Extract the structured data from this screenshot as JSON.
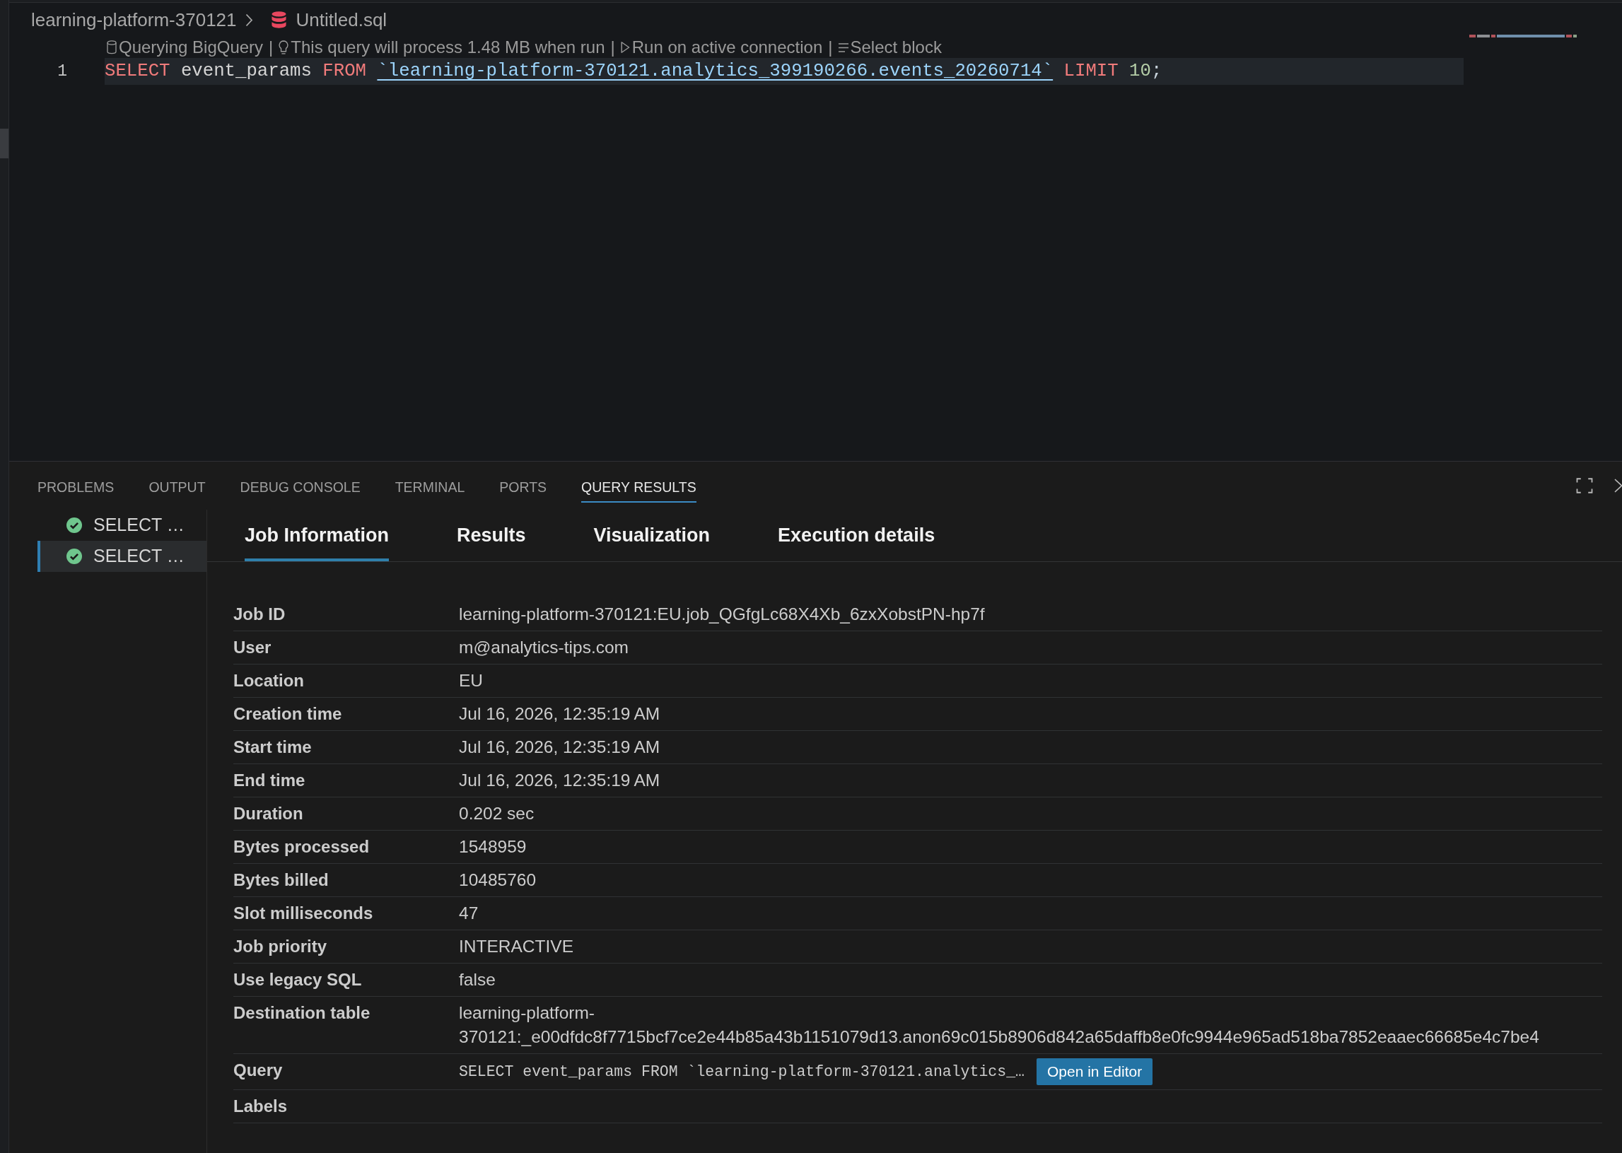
{
  "breadcrumb": [
    {
      "kind": "folder",
      "label": "learning-platform-370121"
    },
    {
      "kind": "sql_file",
      "label": "Untitled.sql"
    }
  ],
  "code_lens": [
    {
      "kind": "database",
      "label": "Querying BigQuery",
      "separator": "|"
    },
    {
      "kind": "lightbulb",
      "label": "This query will process 1.48 MB when run",
      "separator": "|"
    },
    {
      "kind": "run",
      "label": "Run on active connection",
      "separator": "|"
    },
    {
      "kind": "select",
      "label": "Select block"
    }
  ],
  "editor": {
    "lines": [
      {
        "number": "1",
        "current": true,
        "tokens": [
          {
            "kind": "keyword",
            "text": "SELECT"
          },
          {
            "kind": "plain",
            "text": "event_params"
          },
          {
            "kind": "keyword",
            "text": "FROM"
          },
          {
            "kind": "table_ref",
            "text": "`learning-platform-370121.analytics_399190266.events_20260714`"
          },
          {
            "kind": "keyword",
            "text": "LIMIT"
          },
          {
            "kind": "number",
            "text": "10"
          },
          {
            "kind": "punctuation",
            "text": ";"
          }
        ]
      }
    ]
  },
  "panel": {
    "tabs": [
      {
        "label": "PROBLEMS",
        "selected": false
      },
      {
        "label": "OUTPUT",
        "selected": false
      },
      {
        "label": "DEBUG CONSOLE",
        "selected": false
      },
      {
        "label": "TERMINAL",
        "selected": false
      },
      {
        "label": "PORTS",
        "selected": false
      },
      {
        "label": "QUERY RESULTS",
        "selected": true
      }
    ]
  },
  "query_history": [
    {
      "label": "SELECT …",
      "success": true,
      "selected": false
    },
    {
      "label": "SELECT …",
      "success": true,
      "selected": true
    }
  ],
  "result_tabs": [
    {
      "label": "Job Information",
      "selected": true
    },
    {
      "label": "Results",
      "selected": false
    },
    {
      "label": "Visualization",
      "selected": false
    },
    {
      "label": "Execution details",
      "selected": false
    }
  ],
  "job_information": {
    "rows": [
      {
        "kind": "text",
        "label": "Job ID",
        "value": "learning-platform-370121:EU.job_QGfgLc68X4Xb_6zxXobstPN-hp7f"
      },
      {
        "kind": "text",
        "label": "User",
        "value": "m@analytics-tips.com"
      },
      {
        "kind": "text",
        "label": "Location",
        "value": "EU"
      },
      {
        "kind": "text",
        "label": "Creation time",
        "value": "Jul 16, 2026, 12:35:19 AM"
      },
      {
        "kind": "text",
        "label": "Start time",
        "value": "Jul 16, 2026, 12:35:19 AM"
      },
      {
        "kind": "text",
        "label": "End time",
        "value": "Jul 16, 2026, 12:35:19 AM"
      },
      {
        "kind": "text",
        "label": "Duration",
        "value": "0.202 sec"
      },
      {
        "kind": "text",
        "label": "Bytes processed",
        "value": "1548959"
      },
      {
        "kind": "text",
        "label": "Bytes billed",
        "value": "10485760"
      },
      {
        "kind": "text",
        "label": "Slot milliseconds",
        "value": "47"
      },
      {
        "kind": "text",
        "label": "Job priority",
        "value": "INTERACTIVE"
      },
      {
        "kind": "text",
        "label": "Use legacy SQL",
        "value": "false"
      },
      {
        "kind": "text",
        "label": "Destination table",
        "value": "learning-platform-370121:_e00dfdc8f7715bcf7ce2e44b85a43b1151079d13.anon69c015b8906d842a65daffb8e0fc9944e965ad518ba7852eaaec66685e4c7be4"
      },
      {
        "kind": "query",
        "label": "Query",
        "value": "SELECT event_params FROM `learning-platform-370121.analytics_…",
        "button": "Open in Editor"
      },
      {
        "kind": "text",
        "label": "Labels"
      }
    ]
  }
}
